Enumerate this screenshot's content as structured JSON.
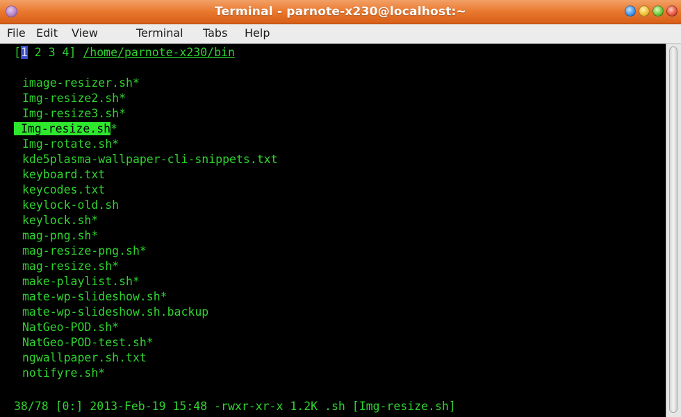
{
  "window": {
    "title": "Terminal - parnote-x230@localhost:~"
  },
  "menubar": {
    "items": [
      "File",
      "Edit",
      "View",
      "Terminal",
      "Tabs",
      "Help"
    ]
  },
  "tabbar": {
    "open_bracket": "[",
    "active_tab": "1",
    "other_tabs": " 2 3 4]",
    "path": "/home/parnote-x230/bin"
  },
  "files": [
    "image-resizer.sh*",
    "Img-resize2.sh*",
    "Img-resize3.sh*",
    "Img-resize.sh*",
    "Img-rotate.sh*",
    "kde5plasma-wallpaper-cli-snippets.txt",
    "keyboard.txt",
    "keycodes.txt",
    "keylock-old.sh",
    "keylock.sh*",
    "mag-png.sh*",
    "mag-resize-png.sh*",
    "mag-resize.sh*",
    "make-playlist.sh*",
    "mate-wp-slideshow.sh*",
    "mate-wp-slideshow.sh.backup",
    "NatGeo-POD.sh*",
    "NatGeo-POD-test.sh*",
    "ngwallpaper.sh.txt",
    "notifyre.sh*"
  ],
  "selected_file": {
    "name": "Img-resize.sh",
    "suffix": "*"
  },
  "statusline": "38/78 [0:] 2013-Feb-19 15:48 -rwxr-xr-x 1.2K .sh [Img-resize.sh]",
  "colors": {
    "text": "#2fd42f",
    "background": "#000000",
    "selection": "#2ee82e",
    "titlebar": "#e9782e"
  }
}
